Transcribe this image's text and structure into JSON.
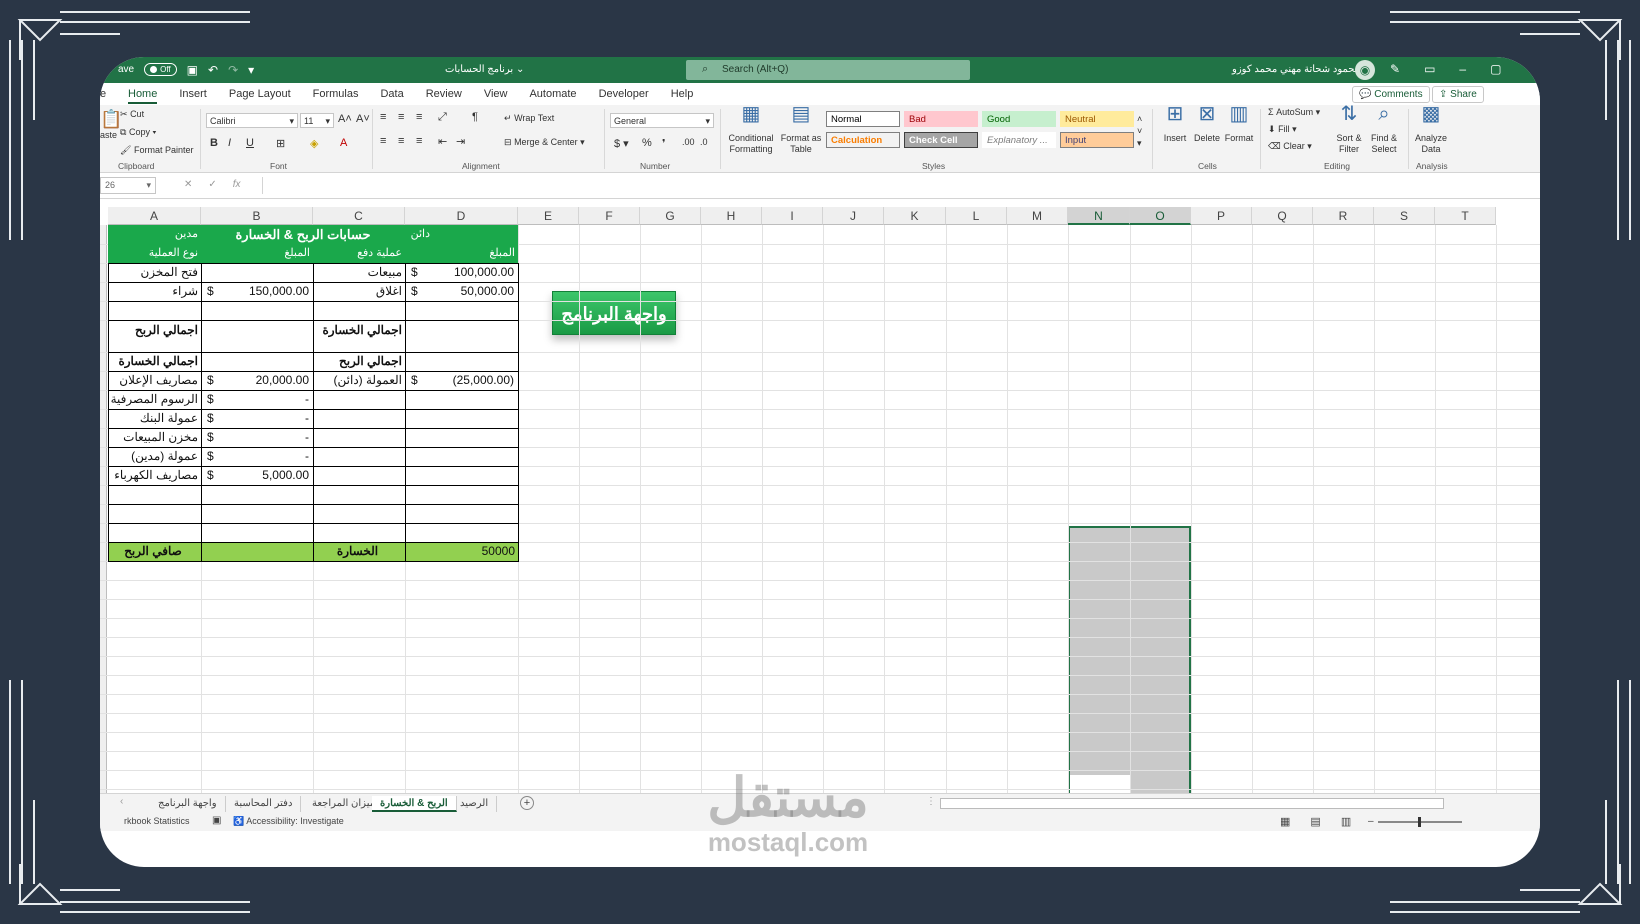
{
  "titlebar": {
    "autosave_label": "ave",
    "autosave_state": "Off",
    "doc_title": "برنامج الحسابات",
    "search_placeholder": "Search (Alt+Q)",
    "user_name": "محمود شحاتة مهني محمد كوزو"
  },
  "menu": {
    "partial_tab": "e",
    "tabs": [
      "Home",
      "Insert",
      "Page Layout",
      "Formulas",
      "Data",
      "Review",
      "View",
      "Automate",
      "Developer",
      "Help"
    ],
    "comments_label": "Comments",
    "share_label": "Share"
  },
  "ribbon": {
    "clipboard": {
      "paste": "aste",
      "cut": "Cut",
      "copy": "Copy",
      "format_painter": "Format Painter",
      "label": "Clipboard"
    },
    "font": {
      "name": "Calibri",
      "size": "11",
      "label": "Font"
    },
    "alignment": {
      "wrap_text": "Wrap Text",
      "merge_center": "Merge & Center",
      "label": "Alignment"
    },
    "number": {
      "format": "General",
      "label": "Number"
    },
    "styles": {
      "conditional": "Conditional Formatting",
      "format_table": "Format as Table",
      "cells": [
        {
          "text": "Normal",
          "bg": "#ffffff",
          "color": "#000000",
          "border": "#7f7f7f"
        },
        {
          "text": "Bad",
          "bg": "#ffc7ce",
          "color": "#9c0006",
          "border": "#ffc7ce"
        },
        {
          "text": "Good",
          "bg": "#c6efce",
          "color": "#006100",
          "border": "#c6efce"
        },
        {
          "text": "Neutral",
          "bg": "#ffeb9c",
          "color": "#9c5700",
          "border": "#ffeb9c"
        },
        {
          "text": "Calculation",
          "bg": "#f2f2f2",
          "color": "#fa7d00",
          "border": "#7f7f7f"
        },
        {
          "text": "Check Cell",
          "bg": "#a5a5a5",
          "color": "#ffffff",
          "border": "#3f3f3f"
        },
        {
          "text": "Explanatory ...",
          "bg": "#ffffff",
          "color": "#7f7f7f",
          "border": "#ffffff"
        },
        {
          "text": "Input",
          "bg": "#ffcc99",
          "color": "#3f3f76",
          "border": "#7f7f7f"
        }
      ],
      "label": "Styles"
    },
    "cells": {
      "insert": "Insert",
      "delete": "Delete",
      "format": "Format",
      "label": "Cells"
    },
    "editing": {
      "autosum": "AutoSum",
      "fill": "Fill",
      "clear": "Clear",
      "sort_filter": "Sort & Filter",
      "find_select": "Find & Select",
      "label": "Editing"
    },
    "analysis": {
      "analyze": "Analyze Data",
      "label": "Analysis"
    }
  },
  "formula": {
    "namebox": "26",
    "fx": "fx"
  },
  "columns": [
    "A",
    "B",
    "C",
    "D",
    "E",
    "F",
    "G",
    "H",
    "I",
    "J",
    "K",
    "L",
    "M",
    "N",
    "O",
    "P",
    "Q",
    "R",
    "S",
    "T"
  ],
  "sheet": {
    "header": {
      "debit": "مدين",
      "title": "حسابات الربح & الخسارة",
      "credit": "دائن"
    },
    "subheader": {
      "a": "نوع العملية",
      "b": "المبلغ",
      "c": "عملية دفع",
      "d": "المبلغ"
    },
    "rows": [
      {
        "a": "فتح المخزن",
        "b_cur": "",
        "b": "",
        "c": "مبيعات",
        "d_cur": "$",
        "d": "100,000.00"
      },
      {
        "a": "شراء",
        "b_cur": "$",
        "b": "150,000.00",
        "c": "اغلاق",
        "d_cur": "$",
        "d": "50,000.00"
      }
    ],
    "total_profit_a": "اجمالي الربح",
    "total_loss_c": "اجمالي الخسارة",
    "total_loss_a": "اجمالي الخسارة",
    "total_profit_c": "اجمالي الربح",
    "expense_rows": [
      {
        "a": "مصاريف الإعلان",
        "b_cur": "$",
        "b": "20,000.00",
        "c": "العمولة (دائن)",
        "d_cur": "$",
        "d": "(25,000.00)"
      },
      {
        "a": "الرسوم المصرفية",
        "b_cur": "$",
        "b": "-",
        "c": "",
        "d_cur": "",
        "d": ""
      },
      {
        "a": "عمولة البنك",
        "b_cur": "$",
        "b": "-",
        "c": "",
        "d_cur": "",
        "d": ""
      },
      {
        "a": "مخزن المبيعات",
        "b_cur": "$",
        "b": "-",
        "c": "",
        "d_cur": "",
        "d": ""
      },
      {
        "a": "عمولة (مدين)",
        "b_cur": "$",
        "b": "-",
        "c": "",
        "d_cur": "",
        "d": ""
      },
      {
        "a": "مصاريف الكهرباء",
        "b_cur": "$",
        "b": "5,000.00",
        "c": "",
        "d_cur": "",
        "d": ""
      }
    ],
    "footer": {
      "a": "صافي الربح",
      "c": "الخسارة",
      "d": "50000"
    },
    "app_button": "واجهة البرنامج"
  },
  "sheet_tabs": [
    {
      "name": "واجهة البرنامج",
      "active": false
    },
    {
      "name": "دفتر المحاسبة",
      "active": false
    },
    {
      "name": "ميزان المراجعة",
      "active": false
    },
    {
      "name": "الربح & الخسارة",
      "active": true
    },
    {
      "name": "الرصيد",
      "active": false
    }
  ],
  "status": {
    "workbook_stats": "rkbook Statistics",
    "accessibility": "Accessibility: Investigate"
  },
  "watermark": {
    "arabic": "مستقل",
    "latin": "mostaql.com"
  },
  "colors": {
    "excel_green": "#217346",
    "table_green": "#1aa84b",
    "footer_green": "#92d050",
    "background": "#2a3646"
  }
}
